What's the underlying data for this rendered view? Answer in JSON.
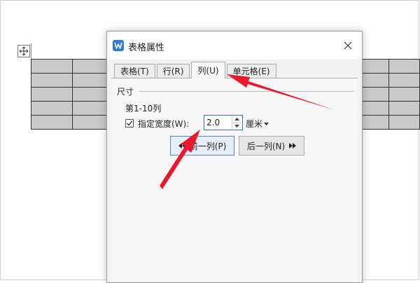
{
  "dialog": {
    "title": "表格属性",
    "tabs": [
      {
        "label": "表格(T)"
      },
      {
        "label": "行(R)"
      },
      {
        "label": "列(U)"
      },
      {
        "label": "单元格(E)"
      }
    ],
    "active_tab": "列(U)",
    "size_section": {
      "label": "尺寸",
      "column_range": "第1-10列",
      "specify_width_label": "指定宽度(W):",
      "specify_width_checked": true,
      "width_value": "2.0",
      "unit_label": "厘米"
    },
    "prev_button_label": "前一列(P)",
    "next_button_label": "后一列(N)"
  },
  "document_table": {
    "rows": 5
  },
  "icons": {
    "move": "move-icon",
    "app": "wps-w-icon",
    "close": "close-icon"
  },
  "colors": {
    "annotation_arrow": "#e8192c",
    "accent_blue": "#2f6fd1",
    "table_fill": "#c9c9c9"
  }
}
